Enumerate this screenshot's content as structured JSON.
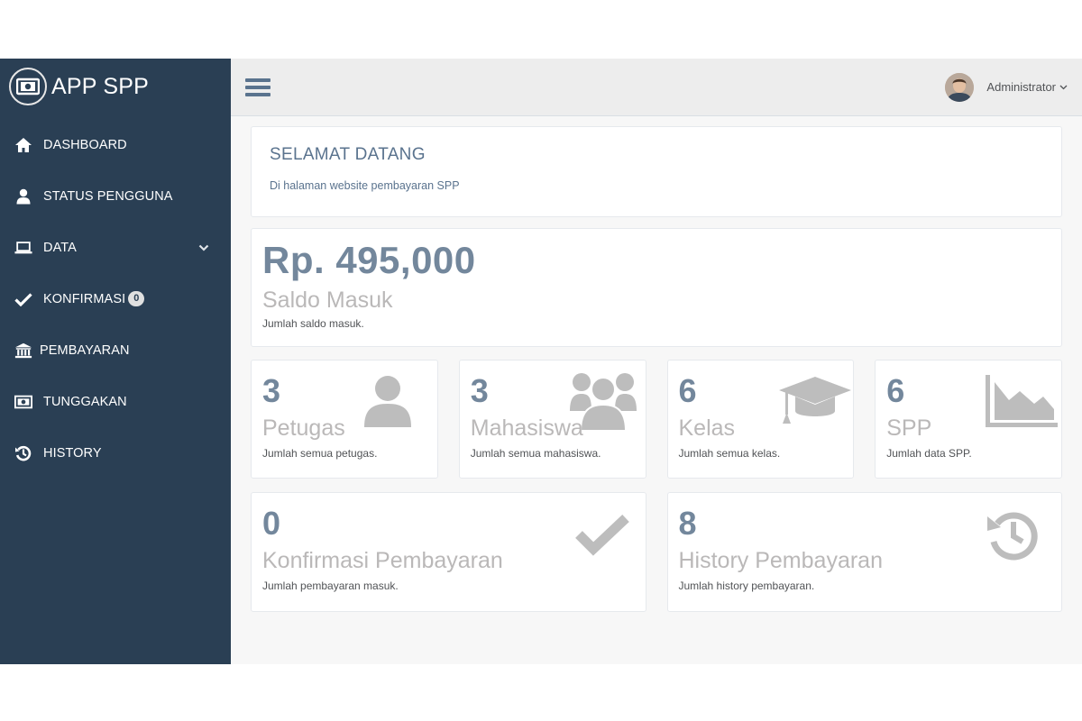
{
  "brand": {
    "title": "APP SPP",
    "icon": "money-icon"
  },
  "sidebar": {
    "items": [
      {
        "label": "DASHBOARD",
        "icon": "home-icon"
      },
      {
        "label": "STATUS PENGGUNA",
        "icon": "user-icon"
      },
      {
        "label": "DATA",
        "icon": "laptop-icon"
      },
      {
        "label": "KONFIRMASI",
        "icon": "check-icon",
        "badge": "0"
      },
      {
        "label": "PEMBAYARAN",
        "icon": "bank-icon"
      },
      {
        "label": "TUNGGAKAN",
        "icon": "money-icon"
      },
      {
        "label": "HISTORY",
        "icon": "history-icon"
      }
    ]
  },
  "header": {
    "user_name": "Administrator"
  },
  "welcome": {
    "title": "SELAMAT DATANG",
    "subtitle": "Di halaman website pembayaran SPP"
  },
  "saldo": {
    "amount": "Rp. 495,000",
    "name": "Saldo Masuk",
    "desc": "Jumlah saldo masuk."
  },
  "tiles": [
    {
      "count": "3",
      "name": "Petugas",
      "desc": "Jumlah semua petugas.",
      "icon": "user-icon"
    },
    {
      "count": "3",
      "name": "Mahasiswa",
      "desc": "Jumlah semua mahasiswa.",
      "icon": "users-icon"
    },
    {
      "count": "6",
      "name": "Kelas",
      "desc": "Jumlah semua kelas.",
      "icon": "graduation-cap-icon"
    },
    {
      "count": "6",
      "name": "SPP",
      "desc": "Jumlah data SPP.",
      "icon": "area-chart-icon"
    }
  ],
  "tiles2": [
    {
      "count": "0",
      "name": "Konfirmasi Pembayaran",
      "desc": "Jumlah pembayaran masuk.",
      "icon": "check-icon"
    },
    {
      "count": "8",
      "name": "History Pembayaran",
      "desc": "Jumlah history pembayaran.",
      "icon": "history-icon"
    }
  ],
  "colors": {
    "sidebar": "#2a3f54",
    "value": "#73879c",
    "muted": "#bab8b8",
    "icon": "#bdbdbd"
  }
}
